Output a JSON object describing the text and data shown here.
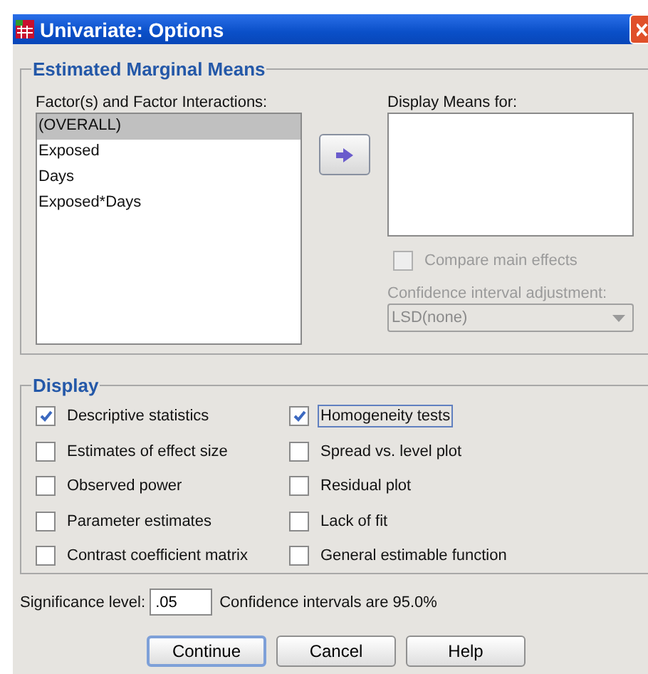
{
  "window": {
    "title": "Univariate: Options"
  },
  "estimated_marginal_means": {
    "title": "Estimated Marginal Means",
    "factors": {
      "label": "Factor(s) and Factor Interactions:",
      "items": [
        {
          "label": "(OVERALL)",
          "selected": true
        },
        {
          "label": "Exposed",
          "selected": false
        },
        {
          "label": "Days",
          "selected": false
        },
        {
          "label": "Exposed*Days",
          "selected": false
        }
      ]
    },
    "display_means": {
      "label": "Display Means for:"
    },
    "compare_main_effects": {
      "label": "Compare main effects",
      "checked": false,
      "disabled": true
    },
    "ci_adjustment": {
      "label": "Confidence interval adjustment:",
      "value": "LSD(none)",
      "disabled": true
    }
  },
  "display": {
    "title": "Display",
    "options": [
      {
        "label": "Descriptive statistics",
        "checked": true,
        "focused": false
      },
      {
        "label": "Homogeneity tests",
        "checked": true,
        "focused": true
      },
      {
        "label": "Estimates of effect size",
        "checked": false,
        "focused": false
      },
      {
        "label": "Spread vs. level plot",
        "checked": false,
        "focused": false
      },
      {
        "label": "Observed power",
        "checked": false,
        "focused": false
      },
      {
        "label": "Residual plot",
        "checked": false,
        "focused": false
      },
      {
        "label": "Parameter estimates",
        "checked": false,
        "focused": false
      },
      {
        "label": "Lack of fit",
        "checked": false,
        "focused": false
      },
      {
        "label": "Contrast coefficient matrix",
        "checked": false,
        "focused": false
      },
      {
        "label": "General estimable function",
        "checked": false,
        "focused": false
      }
    ]
  },
  "significance": {
    "label": "Significance level:",
    "value": ".05",
    "note": "Confidence intervals are 95.0%"
  },
  "buttons": [
    {
      "label": "Continue",
      "default": true
    },
    {
      "label": "Cancel",
      "default": false
    },
    {
      "label": "Help",
      "default": false
    }
  ]
}
